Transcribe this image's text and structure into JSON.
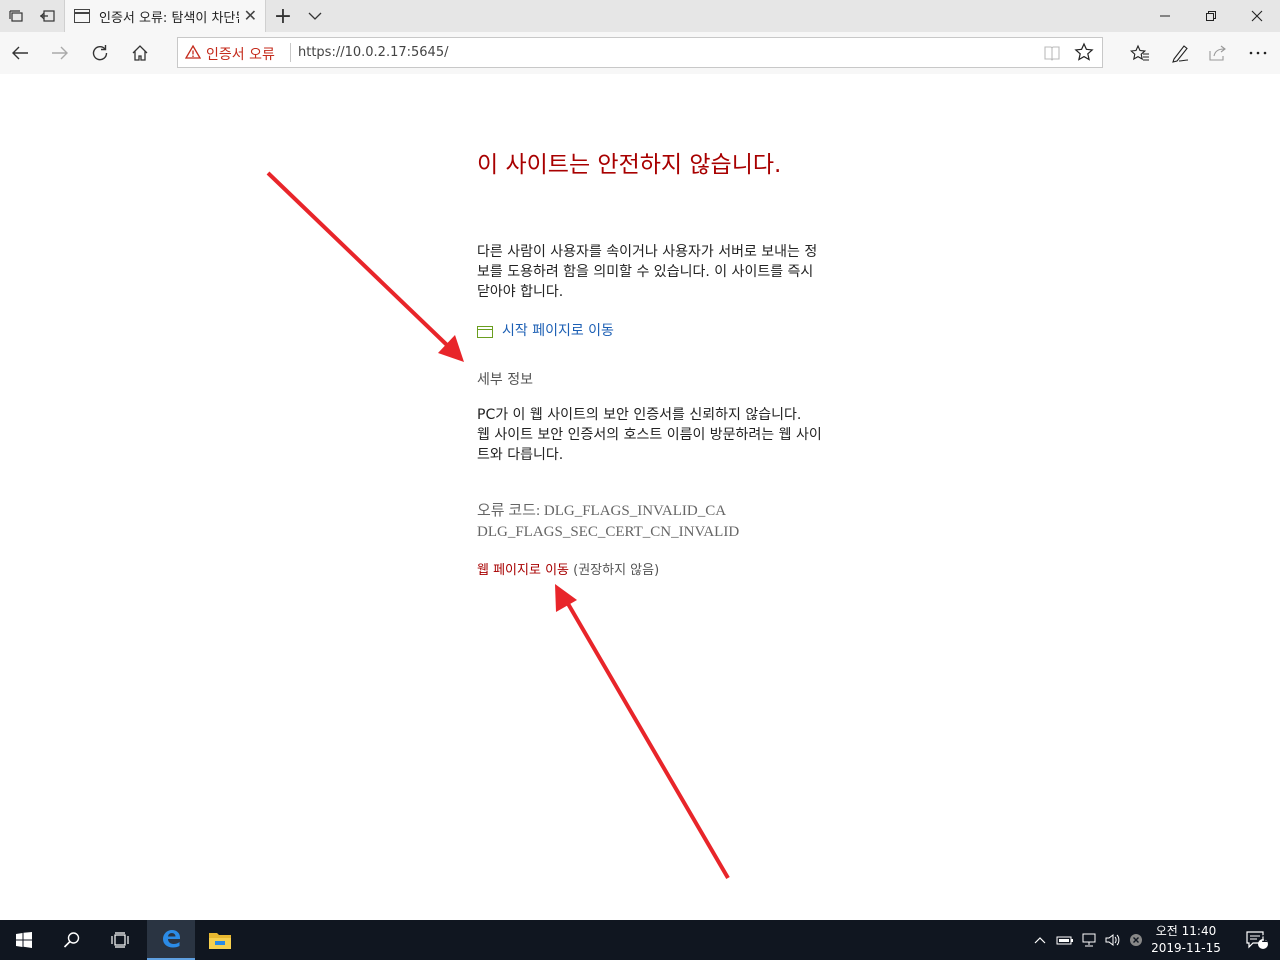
{
  "browser": {
    "tab": {
      "title": "인증서 오류: 탐색이 차단됨",
      "close_glyph": "✕"
    },
    "new_tab_glyph": "+",
    "address_bar": {
      "cert_error_label": "인증서 오류",
      "url": "https://10.0.2.17:5645/"
    }
  },
  "page": {
    "title": "이 사이트는 안전하지 않습니다.",
    "description": "다른 사람이 사용자를 속이거나 사용자가 서버로 보내는 정보를 도용하려 함을 의미할 수 있습니다. 이 사이트를 즉시 닫아야 합니다.",
    "home_link": "시작 페이지로 이동",
    "details_title": "세부 정보",
    "details_line1": "PC가 이 웹 사이트의 보안 인증서를 신뢰하지 않습니다.",
    "details_line2": "웹 사이트 보안 인증서의 호스트 이름이 방문하려는 웹 사이트와 다릅니다.",
    "error_code_line1": "오류 코드: DLG_FLAGS_INVALID_CA",
    "error_code_line2": "DLG_FLAGS_SEC_CERT_CN_INVALID",
    "proceed_link": "웹 페이지로 이동",
    "proceed_note": " (권장하지 않음)"
  },
  "taskbar": {
    "clock_time": "오전 11:40",
    "clock_date": "2019-11-15",
    "notification_count": "1"
  },
  "colors": {
    "title_red": "#a80000",
    "link_blue": "#1c5fb4",
    "annotation_arrow": "#e8252a",
    "taskbar_bg": "#101620"
  },
  "icons": [
    "tab-manager-icon",
    "set-aside-tabs-icon",
    "page-icon",
    "close-icon",
    "plus-icon",
    "chevron-down-icon",
    "minimize-icon",
    "restore-icon",
    "back-icon",
    "forward-icon",
    "refresh-icon",
    "home-icon",
    "warning-icon",
    "reading-view-icon",
    "star-icon",
    "favorites-icon",
    "pen-icon",
    "share-icon",
    "more-icon",
    "windows-start-icon",
    "search-icon",
    "task-view-icon",
    "edge-icon",
    "file-explorer-icon",
    "chevron-up-icon",
    "battery-icon",
    "network-icon",
    "volume-icon",
    "action-center-icon"
  ]
}
